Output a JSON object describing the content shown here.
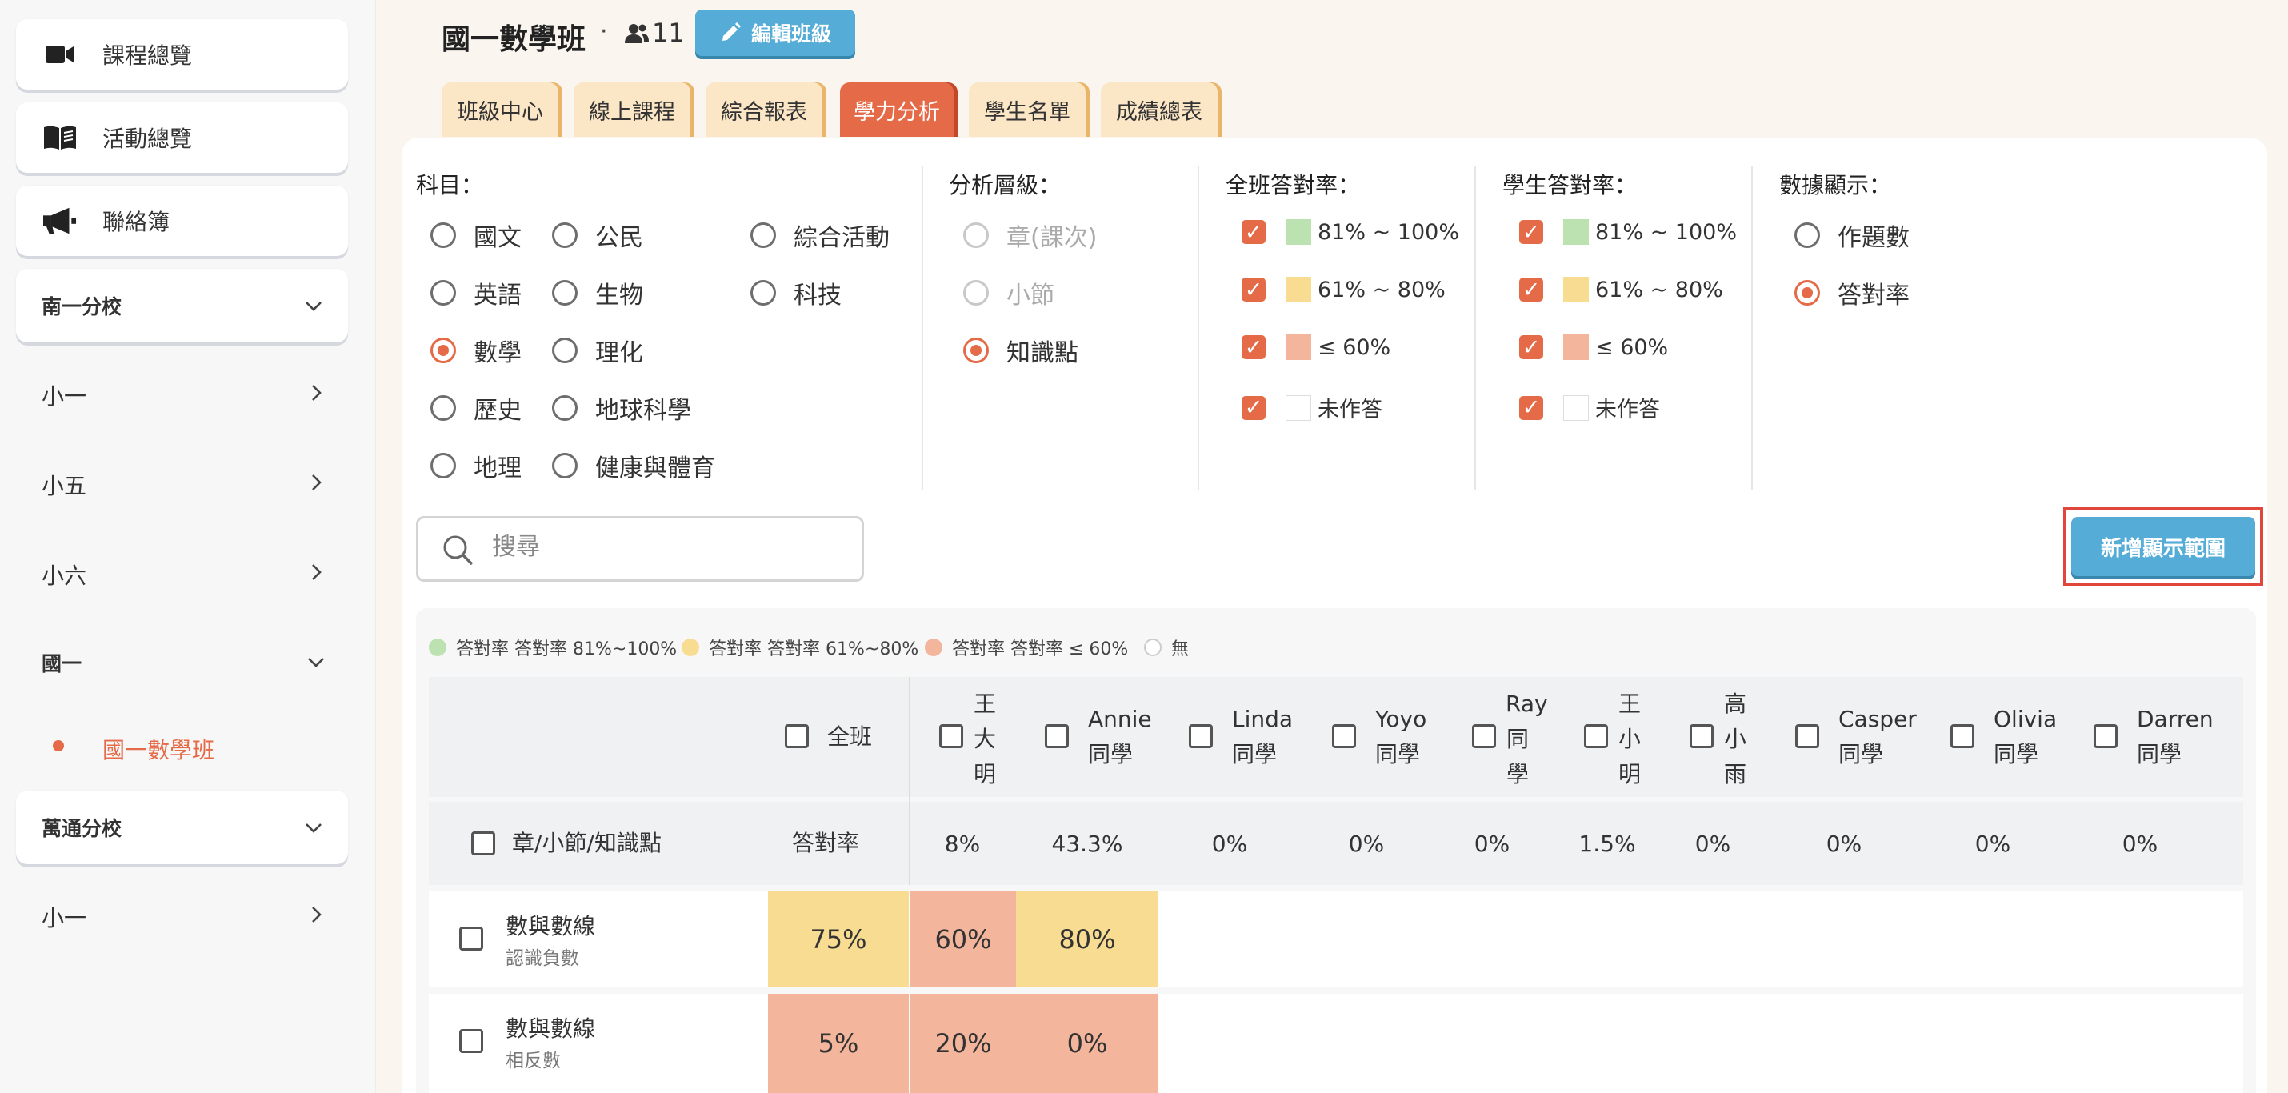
{
  "sidebar": {
    "nav": [
      {
        "label": "課程總覽",
        "icon": "video-camera-icon"
      },
      {
        "label": "活動總覽",
        "icon": "open-book-icon"
      },
      {
        "label": "聯絡簿",
        "icon": "megaphone-icon"
      }
    ],
    "group1": "南一分校",
    "items": [
      "小一",
      "小五",
      "小六"
    ],
    "group_current": "國一",
    "current_class": "國一數學班",
    "group2": "萬通分校",
    "group2_items": [
      "小一"
    ]
  },
  "header": {
    "title": "國一數學班",
    "separator": "·",
    "student_count": "11",
    "edit_button": "編輯班級"
  },
  "tabs": [
    "班級中心",
    "線上課程",
    "綜合報表",
    "學力分析",
    "學生名單",
    "成績總表"
  ],
  "active_tab": "學力分析",
  "filters": {
    "subject": {
      "title": "科目：",
      "options": [
        "國文",
        "公民",
        "綜合活動",
        "英語",
        "生物",
        "科技",
        "數學",
        "理化",
        "歷史",
        "地球科學",
        "地理",
        "健康與體育"
      ],
      "selected": "數學"
    },
    "level": {
      "title": "分析層級：",
      "options": [
        "章(課次)",
        "小節",
        "知識點"
      ],
      "selected": "知識點"
    },
    "class_rate": {
      "title": "全班答對率：",
      "options": [
        "81% ~ 100%",
        "61% ~ 80%",
        "≤ 60%",
        "未作答"
      ]
    },
    "student_rate": {
      "title": "學生答對率：",
      "options": [
        "81% ~ 100%",
        "61% ~ 80%",
        "≤ 60%",
        "未作答"
      ]
    },
    "display": {
      "title": "數據顯示：",
      "options": [
        "作題數",
        "答對率"
      ],
      "selected": "答對率"
    }
  },
  "search": {
    "placeholder": "搜尋"
  },
  "add_range_button": "新增顯示範圍",
  "legend": [
    "答對率 答對率 81%~100%",
    "答對率 答對率 61%~80%",
    "答對率 答對率 ≤ 60%",
    "無"
  ],
  "table": {
    "class_col": "全班",
    "students": [
      {
        "lines": [
          "王",
          "大",
          "明"
        ]
      },
      {
        "lines": [
          "Annie",
          "同學"
        ]
      },
      {
        "lines": [
          "Linda",
          "同學"
        ]
      },
      {
        "lines": [
          "Yoyo",
          "同學"
        ]
      },
      {
        "lines": [
          "Ray",
          "同",
          "學"
        ]
      },
      {
        "lines": [
          "王",
          "小",
          "明"
        ]
      },
      {
        "lines": [
          "高",
          "小",
          "雨"
        ]
      },
      {
        "lines": [
          "Casper",
          "同學"
        ]
      },
      {
        "lines": [
          "Olivia",
          "同學"
        ]
      },
      {
        "lines": [
          "Darren",
          "同學"
        ]
      }
    ],
    "row_header": "章/小節/知識點",
    "rate_label": "答對率",
    "overall_rates": [
      "8%",
      "43.3%",
      "0%",
      "0%",
      "0%",
      "1.5%",
      "0%",
      "0%",
      "0%",
      "0%"
    ],
    "rows": [
      {
        "name": "數與數線",
        "sub": "認識負數",
        "class": "75%",
        "values": [
          "60%",
          "80%"
        ]
      },
      {
        "name": "數與數線",
        "sub": "相反數",
        "class": "5%",
        "values": [
          "20%",
          "0%"
        ]
      }
    ]
  }
}
